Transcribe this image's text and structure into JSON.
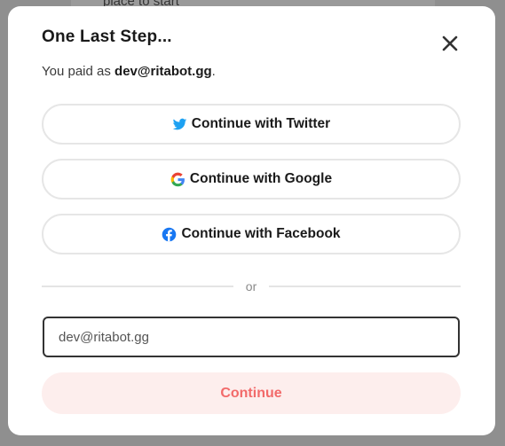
{
  "background": {
    "text": "place to start"
  },
  "modal": {
    "title": "One Last Step...",
    "subtitle_prefix": "You paid as ",
    "email_shown": "dev@ritabot.gg",
    "subtitle_suffix": ".",
    "close_icon": "close-icon"
  },
  "oauth": {
    "twitter": {
      "label": "Continue with Twitter",
      "icon": "twitter-icon",
      "color": "#1DA1F2"
    },
    "google": {
      "label": "Continue with Google",
      "icon": "google-icon"
    },
    "facebook": {
      "label": "Continue with Facebook",
      "icon": "facebook-icon",
      "color": "#1877F2"
    }
  },
  "divider": {
    "label": "or"
  },
  "email_input": {
    "value": "dev@ritabot.gg",
    "placeholder": ""
  },
  "continue_button": {
    "label": "Continue",
    "text_color": "#f26a6a",
    "bg_color": "#fdeeed"
  }
}
